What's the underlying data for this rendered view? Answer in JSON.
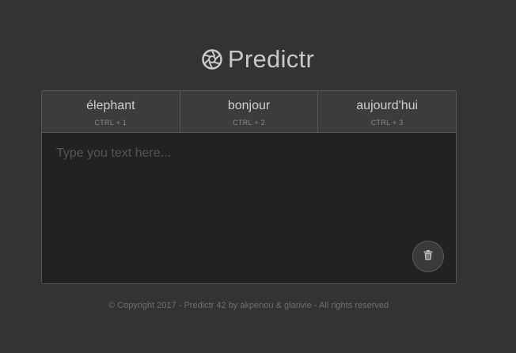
{
  "brand": {
    "title": "Predictr",
    "icon": "aperture-icon"
  },
  "tabs": [
    {
      "word": "élephant",
      "shortcut": "CTRL + 1"
    },
    {
      "word": "bonjour",
      "shortcut": "CTRL + 2"
    },
    {
      "word": "aujourd'hui",
      "shortcut": "CTRL + 3"
    }
  ],
  "editor": {
    "value": "",
    "placeholder": "Type you text here..."
  },
  "clear_button": {
    "icon": "trash-icon"
  },
  "footer": {
    "text": "© Copyright 2017 - Predictr 42 by akpenou & glarivie - All rights reserved"
  },
  "colors": {
    "background": "#333333",
    "card": "#222222",
    "tabs": "#3c3c3c",
    "border": "#555555"
  }
}
